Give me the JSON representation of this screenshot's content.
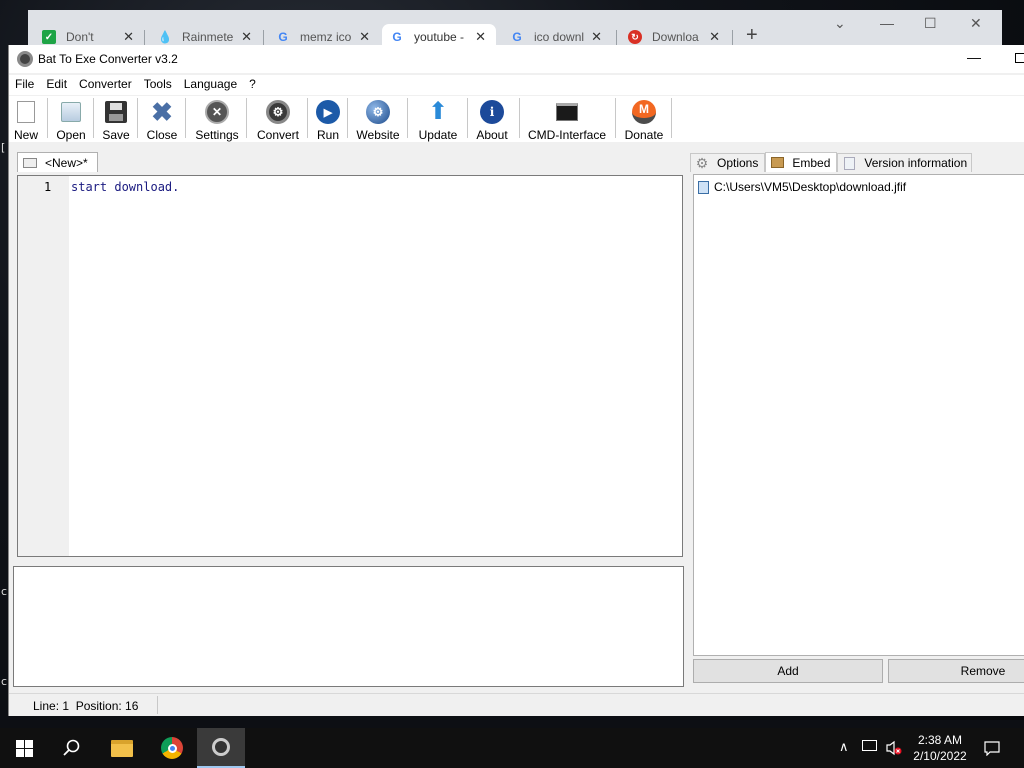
{
  "desktop": {
    "side_chars": [
      "[",
      "c",
      "c"
    ]
  },
  "browser": {
    "tabs": [
      {
        "title": "Don't",
        "icon": "checkbox-icon",
        "color": "#1ea446"
      },
      {
        "title": "Rainmete",
        "icon": "droplet-icon",
        "color": "#4a90d9"
      },
      {
        "title": "memz ico",
        "icon": "google-icon",
        "color": "#4285f4"
      },
      {
        "title": "youtube -",
        "icon": "google-icon",
        "color": "#4285f4"
      },
      {
        "title": "ico downl",
        "icon": "google-icon",
        "color": "#4285f4"
      },
      {
        "title": "Downloa",
        "icon": "download-site-icon",
        "color": "#d93025"
      }
    ],
    "new_tab": "+",
    "window_controls": {
      "collapse": "⌄",
      "minimize": "—",
      "maximize": "☐",
      "close": "✕"
    }
  },
  "app": {
    "title": "Bat To Exe Converter v3.2",
    "min_glyph": "—",
    "menu": [
      "File",
      "Edit",
      "Converter",
      "Tools",
      "Language",
      "?"
    ],
    "toolbar": {
      "new": "New",
      "open": "Open",
      "save": "Save",
      "close": "Close",
      "settings": "Settings",
      "convert": "Convert",
      "run": "Run",
      "website": "Website",
      "update": "Update",
      "about": "About",
      "cmd": "CMD-Interface",
      "donate": "Donate"
    },
    "editor_tab": "<New>*",
    "editor": {
      "line_number": "1",
      "code": "start download."
    },
    "right_tabs": {
      "options": "Options",
      "embed": "Embed",
      "version": "Version information"
    },
    "embed_files": [
      "C:\\Users\\VM5\\Desktop\\download.jfif"
    ],
    "buttons": {
      "add": "Add",
      "remove": "Remove"
    },
    "status": "Line: 1  Position: 16"
  },
  "taskbar": {
    "time": "2:38 AM",
    "date": "2/10/2022",
    "tray": {
      "chevron": "∧"
    }
  }
}
